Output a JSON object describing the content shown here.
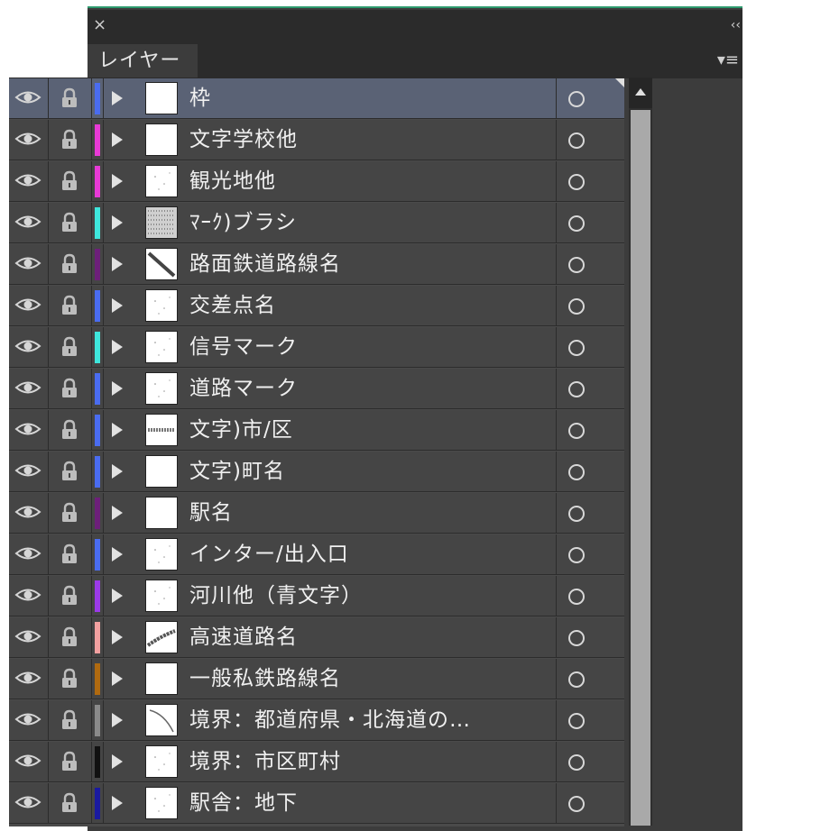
{
  "panel": {
    "close_glyph": "×",
    "collapse_glyph": "‹‹",
    "tab_label": "レイヤー",
    "menu_glyph": "▾≡"
  },
  "layers": [
    {
      "name": "枠",
      "color": "#4a6cf0",
      "selected": true,
      "thumb": "blank"
    },
    {
      "name": "文字学校他",
      "color": "#e83ad6",
      "selected": false,
      "thumb": "blank"
    },
    {
      "name": "観光地他",
      "color": "#e83ad6",
      "selected": false,
      "thumb": "dots"
    },
    {
      "name": "ﾏｰｸ)ブラシ",
      "color": "#3ee6dc",
      "selected": false,
      "thumb": "noise"
    },
    {
      "name": "路面鉄道路線名",
      "color": "#6d1f7a",
      "selected": false,
      "thumb": "diagonal"
    },
    {
      "name": "交差点名",
      "color": "#4a6cf0",
      "selected": false,
      "thumb": "dots"
    },
    {
      "name": "信号マーク",
      "color": "#3ee6dc",
      "selected": false,
      "thumb": "dots"
    },
    {
      "name": "道路マーク",
      "color": "#4a6cf0",
      "selected": false,
      "thumb": "dots"
    },
    {
      "name": "文字)市/区",
      "color": "#4a6cf0",
      "selected": false,
      "thumb": "band"
    },
    {
      "name": "文字)町名",
      "color": "#4a6cf0",
      "selected": false,
      "thumb": "blank"
    },
    {
      "name": "駅名",
      "color": "#6d1f7a",
      "selected": false,
      "thumb": "blank"
    },
    {
      "name": "インター/出入口",
      "color": "#4a6cf0",
      "selected": false,
      "thumb": "dots"
    },
    {
      "name": "河川他（青文字）",
      "color": "#9b3ae8",
      "selected": false,
      "thumb": "dots"
    },
    {
      "name": "高速道路名",
      "color": "#f2a0a0",
      "selected": false,
      "thumb": "curve"
    },
    {
      "name": "一般私鉄路線名",
      "color": "#b06a10",
      "selected": false,
      "thumb": "blank"
    },
    {
      "name": "境界：都道府県・北海道の…",
      "color": "#8a8a8a",
      "selected": false,
      "thumb": "arc"
    },
    {
      "name": "境界：市区町村",
      "color": "#111111",
      "selected": false,
      "thumb": "dots"
    },
    {
      "name": "駅舎：地下",
      "color": "#1a1aa0",
      "selected": false,
      "thumb": "dots"
    }
  ],
  "icons": {
    "visibility": "eye-icon",
    "lock": "lock-icon",
    "expand": "triangle-right-icon",
    "target": "circle-target-icon"
  }
}
